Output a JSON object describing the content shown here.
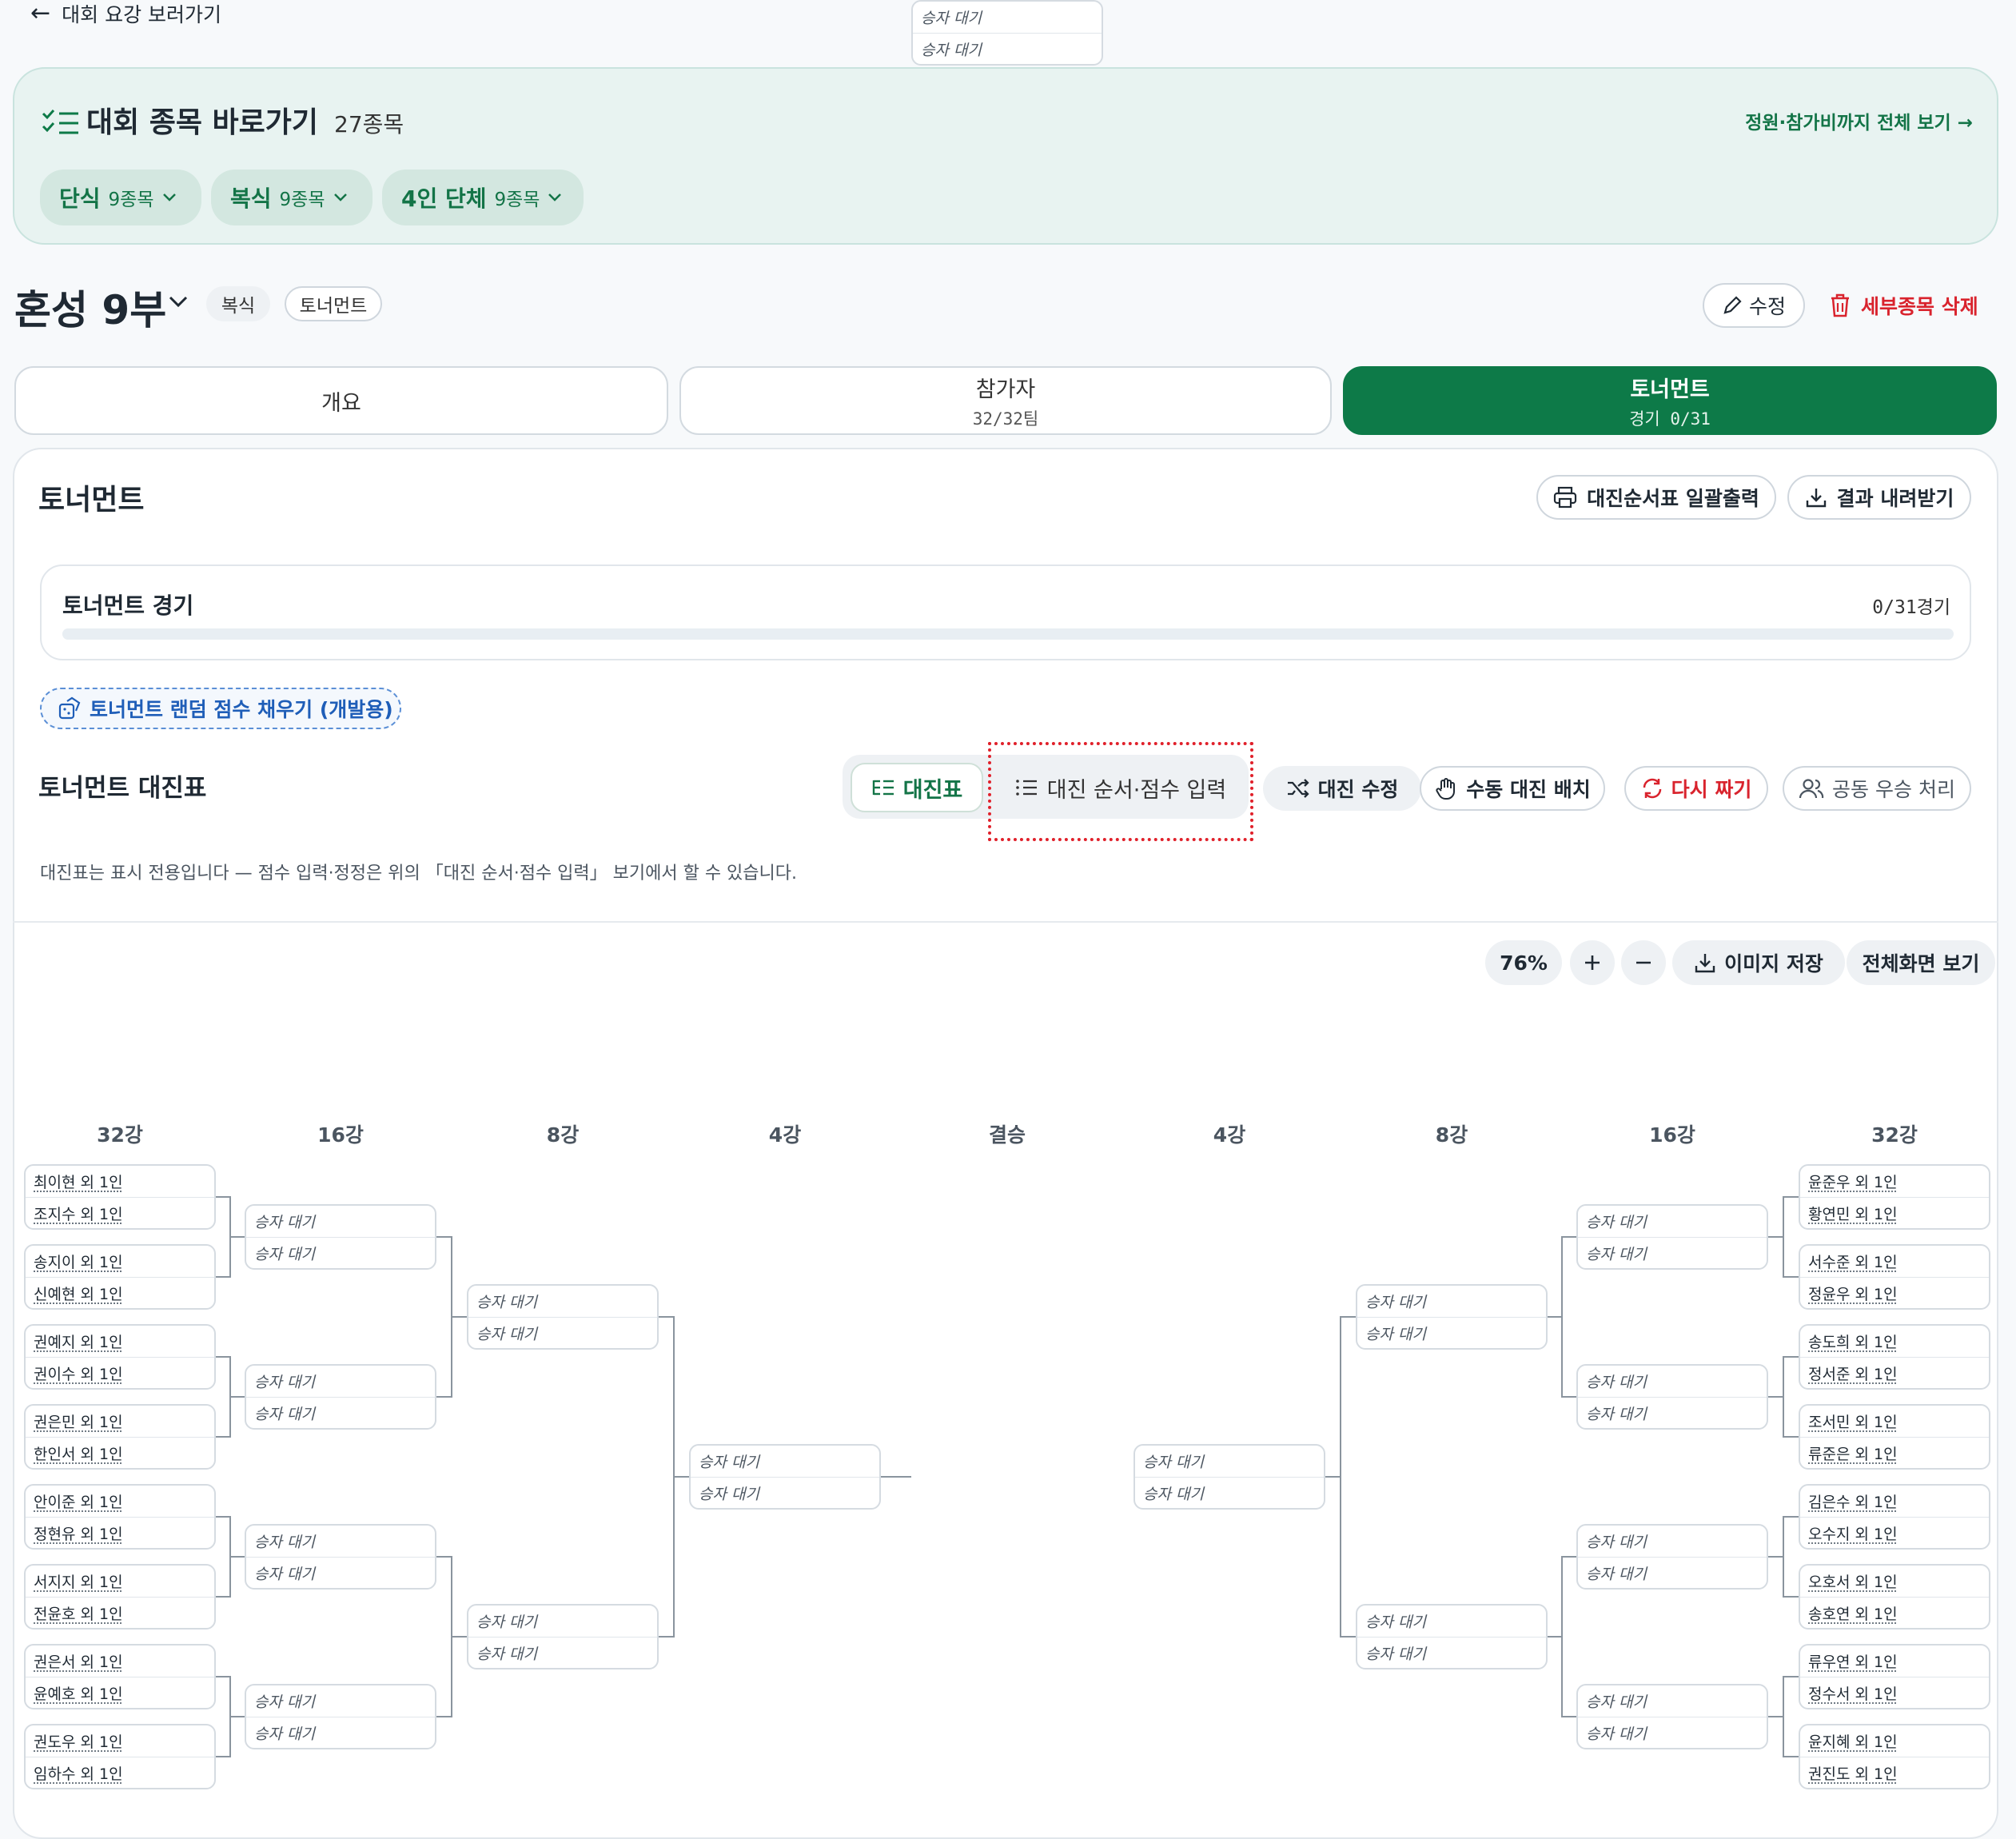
{
  "back_link": {
    "label": "대회 요강 보러가기"
  },
  "event_panel": {
    "title": "대회 종목 바로가기",
    "count": "27종목",
    "view_all": "정원·참가비까지 전체 보기 →",
    "chips": [
      {
        "label": "단식",
        "count": "9종목"
      },
      {
        "label": "복식",
        "count": "9종목"
      },
      {
        "label": "4인 단체",
        "count": "9종목"
      }
    ]
  },
  "division": {
    "name": "혼성 9부",
    "tags": [
      "복식",
      "토너먼트"
    ],
    "edit_label": "수정",
    "delete_label": "세부종목 삭제"
  },
  "tabs": [
    {
      "label": "개요",
      "sub": ""
    },
    {
      "label": "참가자",
      "sub": "32/32팀"
    },
    {
      "label": "토너먼트",
      "sub": "경기 0/31",
      "active": true
    }
  ],
  "tournament": {
    "title": "토너먼트",
    "print_label": "대진순서표 일괄출력",
    "download_label": "결과 내려받기",
    "progress": {
      "label": "토너먼트 경기",
      "count": "0/31경기",
      "completed": 0,
      "total": 31
    },
    "dev_fill_label": "토너먼트 랜덤 점수 채우기 (개발용)"
  },
  "bracket_section": {
    "title": "토너먼트 대진표",
    "view_bracket": "대진표",
    "view_order": "대진 순서·점수 입력",
    "edit_draw": "대진 수정",
    "manual_draw": "수동 대진 배치",
    "redraw": "다시 짜기",
    "joint_win": "공동 우승 처리",
    "note": "대진표는 표시 전용입니다 — 점수 입력·정정은 위의 「대진 순서·점수 입력」 보기에서 할 수 있습니다.",
    "zoom": "76%",
    "save_image": "이미지 저장",
    "fullscreen": "전체화면 보기",
    "accent_color": "#0d7a48",
    "danger_color": "#d9232d"
  },
  "bracket": {
    "rounds": [
      "32강",
      "16강",
      "8강",
      "4강",
      "결승",
      "4강",
      "8강",
      "16강",
      "32강"
    ],
    "pending_label": "승자 대기",
    "left_teams": [
      [
        "최이현 외 1인",
        "조지수 외 1인"
      ],
      [
        "송지이 외 1인",
        "신예현 외 1인"
      ],
      [
        "권예지 외 1인",
        "권이수 외 1인"
      ],
      [
        "권은민 외 1인",
        "한인서 외 1인"
      ],
      [
        "안이준 외 1인",
        "정현유 외 1인"
      ],
      [
        "서지지 외 1인",
        "전윤호 외 1인"
      ],
      [
        "권은서 외 1인",
        "윤예호 외 1인"
      ],
      [
        "권도우 외 1인",
        "임하수 외 1인"
      ]
    ],
    "right_teams": [
      [
        "윤준우 외 1인",
        "황연민 외 1인"
      ],
      [
        "서수준 외 1인",
        "정윤우 외 1인"
      ],
      [
        "송도희 외 1인",
        "정서준 외 1인"
      ],
      [
        "조서민 외 1인",
        "류준은 외 1인"
      ],
      [
        "김은수 외 1인",
        "오수지 외 1인"
      ],
      [
        "오호서 외 1인",
        "송호연 외 1인"
      ],
      [
        "류우연 외 1인",
        "정수서 외 1인"
      ],
      [
        "윤지혜 외 1인",
        "권진도 외 1인"
      ]
    ]
  }
}
